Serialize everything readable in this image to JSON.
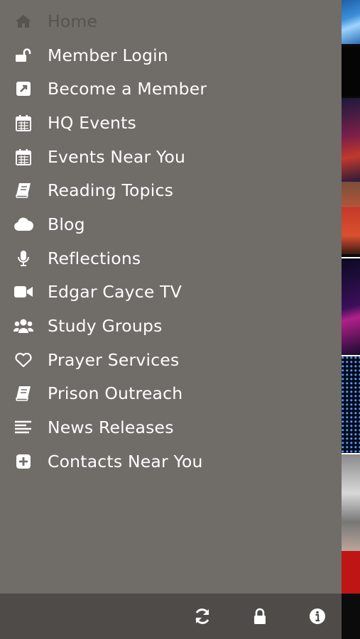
{
  "drawer": {
    "items": [
      {
        "label": "Home",
        "icon": "home-icon",
        "active": true
      },
      {
        "label": "Member Login",
        "icon": "unlock-icon"
      },
      {
        "label": "Become a Member",
        "icon": "external-link-icon"
      },
      {
        "label": "HQ Events",
        "icon": "calendar-icon"
      },
      {
        "label": "Events Near You",
        "icon": "calendar-icon"
      },
      {
        "label": "Reading Topics",
        "icon": "book-icon"
      },
      {
        "label": "Blog",
        "icon": "cloud-icon"
      },
      {
        "label": "Reflections",
        "icon": "microphone-icon"
      },
      {
        "label": "Edgar Cayce TV",
        "icon": "video-camera-icon"
      },
      {
        "label": "Study Groups",
        "icon": "users-icon"
      },
      {
        "label": "Prayer Services",
        "icon": "heart-icon"
      },
      {
        "label": "Prison Outreach",
        "icon": "book-icon"
      },
      {
        "label": "News Releases",
        "icon": "align-left-icon"
      },
      {
        "label": "Contacts Near You",
        "icon": "plus-square-icon"
      }
    ]
  },
  "toolbar": {
    "buttons": [
      {
        "icon": "refresh-icon"
      },
      {
        "icon": "lock-icon"
      },
      {
        "icon": "info-icon"
      }
    ]
  },
  "colors": {
    "drawer_bg": "#706c68",
    "toolbar_bg": "#4e4b48",
    "text": "#ffffff",
    "active_text": "#565350"
  }
}
